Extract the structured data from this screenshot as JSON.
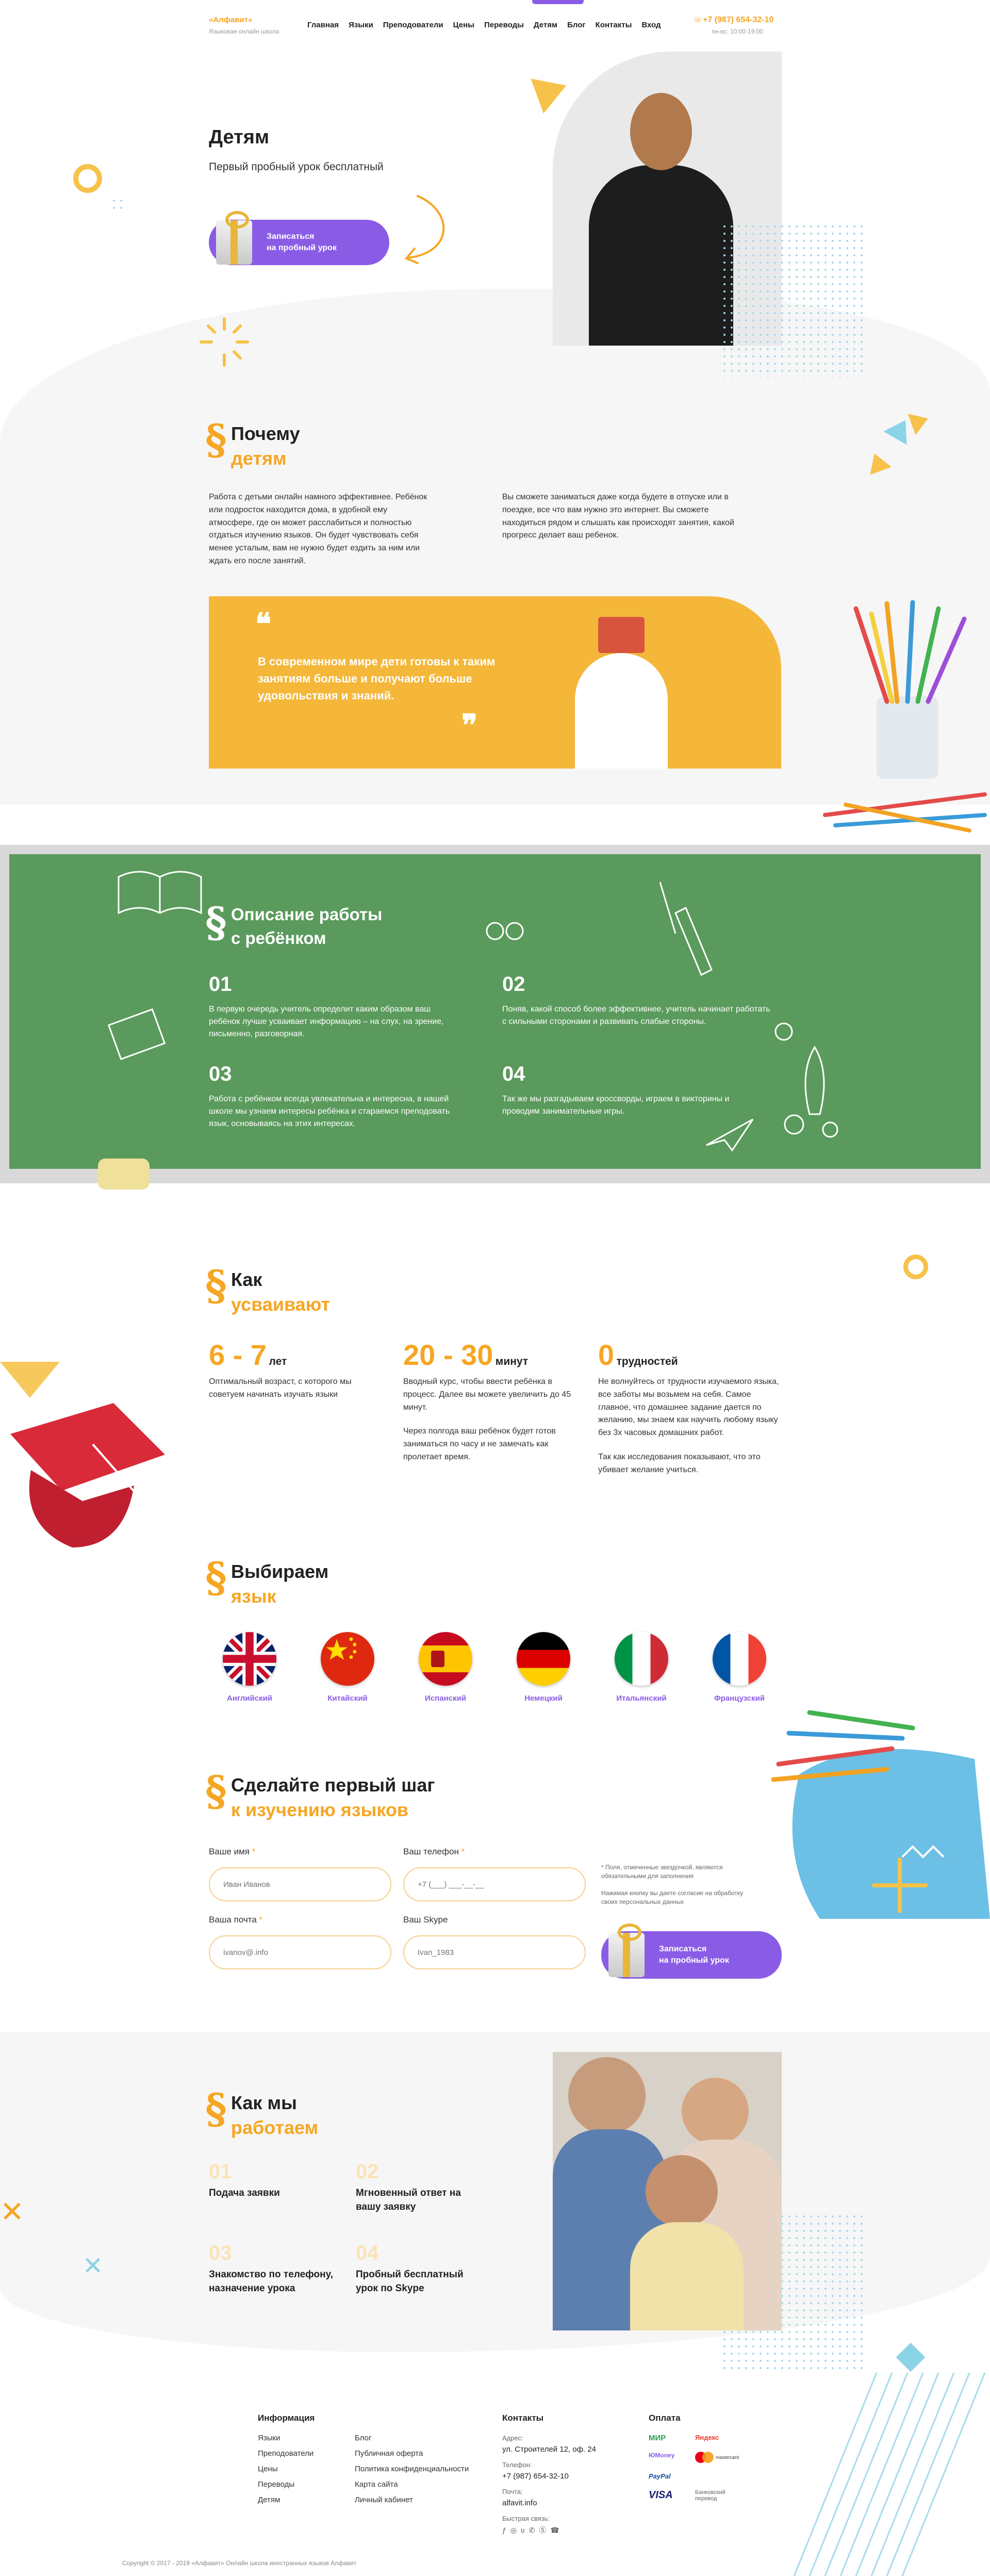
{
  "header": {
    "logo": "«Алфавит»",
    "logo_sub": "Языковая онлайн школа",
    "nav": [
      "Главная",
      "Языки",
      "Преподователи",
      "Цены",
      "Переводы",
      "Детям",
      "Блог",
      "Контакты",
      "Вход"
    ],
    "phone": "+7 (987) 654-32-10",
    "hours": "пн-вс: 10:00-19:00"
  },
  "hero": {
    "title": "Детям",
    "subtitle": "Первый пробный урок бесплатный",
    "cta_line1": "Записаться",
    "cta_line2": "на пробный урок"
  },
  "why": {
    "title1": "Почему",
    "title2": "детям",
    "left_text": "Работа с детьми онлайн намного эффективнее. Ребёнок или подросток находится дома, в удобной ему атмосфере, где он может расслабиться и полностью отдаться изучению языков. Он будет чувствовать себя менее усталым, вам не нужно будет ездить за ним или ждать его после занятий.",
    "right_text": "Вы сможете заниматься даже когда будете в отпуске или в поездке, все что вам нужно это интернет. Вы сможете находиться рядом и слышать как происходят занятия, какой прогресс делает ваш ребенок.",
    "quote_open": "❝",
    "quote": "В современном мире дети готовы к таким занятиям больше и получают больше удовольствия и знаний.",
    "quote_close": "❞"
  },
  "board": {
    "title1": "Описание работы",
    "title2": "с ребёнком",
    "items": [
      {
        "n": "01",
        "text": "В первую очередь учитель определит каким образом ваш ребёнок лучше усваивает информацию – на слух, на зрение, письменно, разговорная."
      },
      {
        "n": "02",
        "text": "Поняв, какой способ более эффективнее, учитель начинает работать с сильными сторонами и развивать слабые стороны."
      },
      {
        "n": "03",
        "text": "Работа с ребёнком всегда увлекательна и интересна, в нашей школе мы узнаем интересы ребёнка и стараемся преподовать язык, основываясь на этих интересах."
      },
      {
        "n": "04",
        "text": "Так же мы разгадываем кроссворды, играем в викторины и проводим занимательные игры."
      }
    ]
  },
  "how": {
    "title1": "Как",
    "title2": "усваивают",
    "stats": [
      {
        "big": "6 - 7",
        "small": "лет",
        "text": "Оптимальный возраст, с которого мы советуем начинать изучать языки",
        "text2": ""
      },
      {
        "big": "20 - 30",
        "small": "минут",
        "text": "Вводный курс, чтобы ввести ребёнка в процесс. Далее вы можете увеличить до 45 минут.",
        "text2": "Через полгода ваш ребёнок будет готов заниматься по часу и не замечать как пролетает время."
      },
      {
        "big": "0",
        "small": "трудностей",
        "text": "Не волнуйтесь от трудности изучаемого языка, все заботы мы возьмем на себя. Самое главное, что домашнее задание дается по желанию, мы знаем как научить любому языку без 3х часовых домашних работ.",
        "text2": "Так как исследования показывают, что это убивает желание учиться."
      }
    ]
  },
  "langs": {
    "title1": "Выбираем",
    "title2": "язык",
    "items": [
      "Английский",
      "Китайский",
      "Испанский",
      "Немецкий",
      "Итальянский",
      "Французский"
    ]
  },
  "form": {
    "title1": "Сделайте первый шаг",
    "title2": "к изучению языков",
    "name_label": "Ваше имя",
    "name_ph": "Иван Иванов",
    "phone_label": "Ваш телефон",
    "phone_ph": "+7 (___) ___-__-__",
    "email_label": "Ваша почта",
    "email_ph": "ivanov@.info",
    "skype_label": "Ваш Skype",
    "skype_ph": "Ivan_1983",
    "req_mark": "*",
    "note1": "* Поля, отмеченные звездочкой, являются обязательными для заполнения",
    "note2": "Нажимая кнопку вы даете согласие на обработку своих персональных данных",
    "cta_line1": "Записаться",
    "cta_line2": "на пробный урок"
  },
  "work": {
    "title1": "Как мы",
    "title2": "работаем",
    "steps": [
      {
        "n": "01",
        "text": "Подача заявки"
      },
      {
        "n": "02",
        "text": "Мгновенный ответ на вашу заявку"
      },
      {
        "n": "03",
        "text": "Знакомство по телефону, назначение урока"
      },
      {
        "n": "04",
        "text": "Пробный бесплатный урок по Skype"
      }
    ]
  },
  "footer": {
    "info_title": "Информация",
    "col1": [
      "Языки",
      "Преподователи",
      "Цены",
      "Переводы",
      "Детям"
    ],
    "col2": [
      "Блог",
      "Публичная оферта",
      "Политика конфиденциальности",
      "Карта сайта",
      "Личный кабинет"
    ],
    "contacts_title": "Контакты",
    "address_label": "Адрес:",
    "address": "ул. Строителей 12, оф. 24",
    "phone_label": "Телефон:",
    "phone": "+7 (987) 654-32-10",
    "mail_label": "Почта:",
    "mail": "alfavit.info",
    "fast_label": "Быстрая связь:",
    "pay_title": "Оплата",
    "pay": [
      "МИР",
      "Яндекс",
      "ЮMoney",
      "mastercard",
      "PayPal",
      "VISA"
    ],
    "pay_note": "Банковский перевод",
    "copyright": "Copyright © 2017 - 2019 «Алфавит» Онлайн школа иностранных языков Алфавит"
  }
}
